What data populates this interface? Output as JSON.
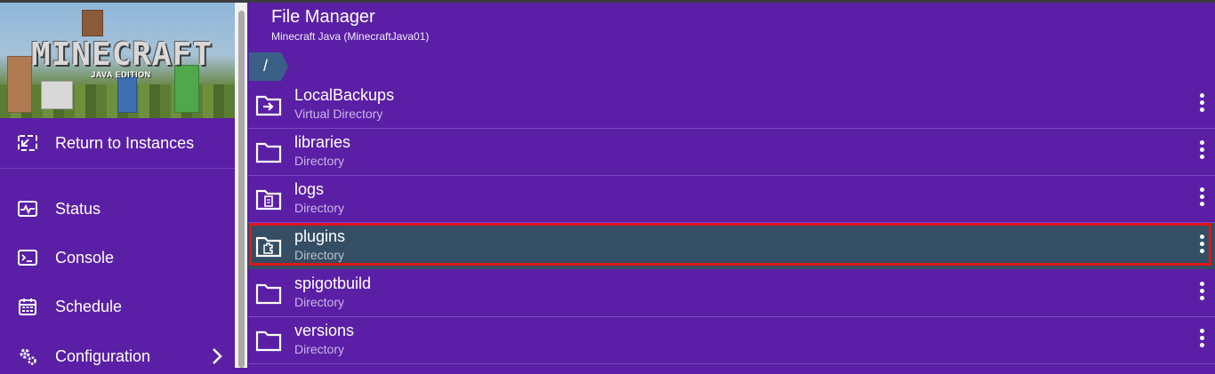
{
  "app": {
    "logo_text": "MINECRAFT",
    "logo_subtitle": "JAVA EDITION"
  },
  "sidebar": {
    "return_label": "Return to Instances",
    "items": [
      {
        "label": "Status",
        "icon": "status-icon"
      },
      {
        "label": "Console",
        "icon": "console-icon"
      },
      {
        "label": "Schedule",
        "icon": "calendar-icon"
      },
      {
        "label": "Configuration",
        "icon": "gears-icon"
      }
    ]
  },
  "header": {
    "title": "File Manager",
    "subtitle": "Minecraft Java (MinecraftJava01)",
    "breadcrumb": "/"
  },
  "files": [
    {
      "name": "LocalBackups",
      "type": "Virtual Directory",
      "icon": "virtual-folder-icon"
    },
    {
      "name": "libraries",
      "type": "Directory",
      "icon": "folder-icon"
    },
    {
      "name": "logs",
      "type": "Directory",
      "icon": "logs-folder-icon"
    },
    {
      "name": "plugins",
      "type": "Directory",
      "icon": "plugin-folder-icon",
      "selected": true
    },
    {
      "name": "spigotbuild",
      "type": "Directory",
      "icon": "folder-icon"
    },
    {
      "name": "versions",
      "type": "Directory",
      "icon": "folder-icon"
    }
  ],
  "colors": {
    "background": "#5b1fa6",
    "selected_row": "#344e63",
    "highlight_border": "#e0141b"
  }
}
